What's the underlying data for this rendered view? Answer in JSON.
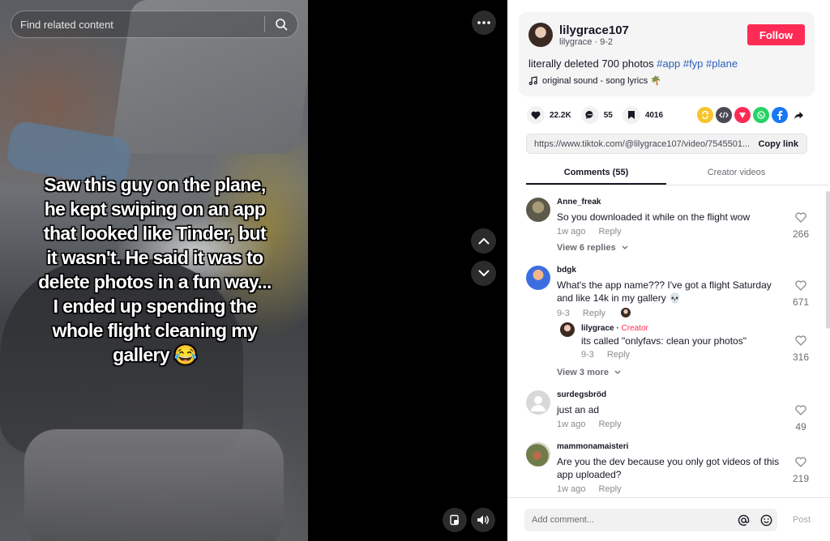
{
  "search": {
    "placeholder": "Find related content"
  },
  "video": {
    "caption": "Saw this guy on the plane,\nhe kept swiping on an app\nthat looked like Tinder, but\nit wasn't. He said it was to\ndelete photos in a fun way...\nI ended up spending the\nwhole flight cleaning my\ngallery 😂"
  },
  "post": {
    "username": "lilygrace107",
    "handle": "lilygrace",
    "date": "9-2",
    "follow_label": "Follow",
    "description_text": "literally deleted 700 photos",
    "hashtags": [
      "#app",
      "#fyp",
      "#plane"
    ],
    "sound": "original sound - song lyrics 🌴",
    "likes": "22.2K",
    "comments_count": "55",
    "saves": "4016",
    "link": "https://www.tiktok.com/@lilygrace107/video/7545501...",
    "copy_link_label": "Copy link"
  },
  "share_icons": [
    {
      "name": "repost-icon",
      "color": "#f7c52b"
    },
    {
      "name": "embed-icon",
      "color": "#4a4a55"
    },
    {
      "name": "send-icon",
      "color": "#fe2c55"
    },
    {
      "name": "whatsapp-icon",
      "color": "#25d366"
    },
    {
      "name": "facebook-icon",
      "color": "#1877f2"
    }
  ],
  "tabs": [
    {
      "label": "Comments (55)",
      "active": true
    },
    {
      "label": "Creator videos",
      "active": false
    }
  ],
  "comments": [
    {
      "user": "Anne_freak",
      "text": "So you downloaded it while on the flight wow",
      "date": "1w ago",
      "likes": "266",
      "view_replies": "View 6 replies"
    },
    {
      "user": "bdgk",
      "text": "What's the app name??? I've got a flight Saturday and like 14k in my gallery 💀",
      "date": "9-3",
      "likes": "671",
      "reply": {
        "user": "lilygrace",
        "tag": "Creator",
        "text": "its called \"onlyfavs: clean your photos\"",
        "date": "9-3",
        "likes": "316"
      },
      "view_replies": "View 3 more"
    },
    {
      "user": "surdegsbröd",
      "text": "just an ad",
      "date": "1w ago",
      "likes": "49"
    },
    {
      "user": "mammonamaisteri",
      "text": "Are you the dev because you only got videos of this app uploaded?",
      "date": "1w ago",
      "likes": "219"
    }
  ],
  "labels": {
    "reply": "Reply",
    "separator": " · "
  },
  "composer": {
    "placeholder": "Add comment...",
    "post_label": "Post"
  }
}
